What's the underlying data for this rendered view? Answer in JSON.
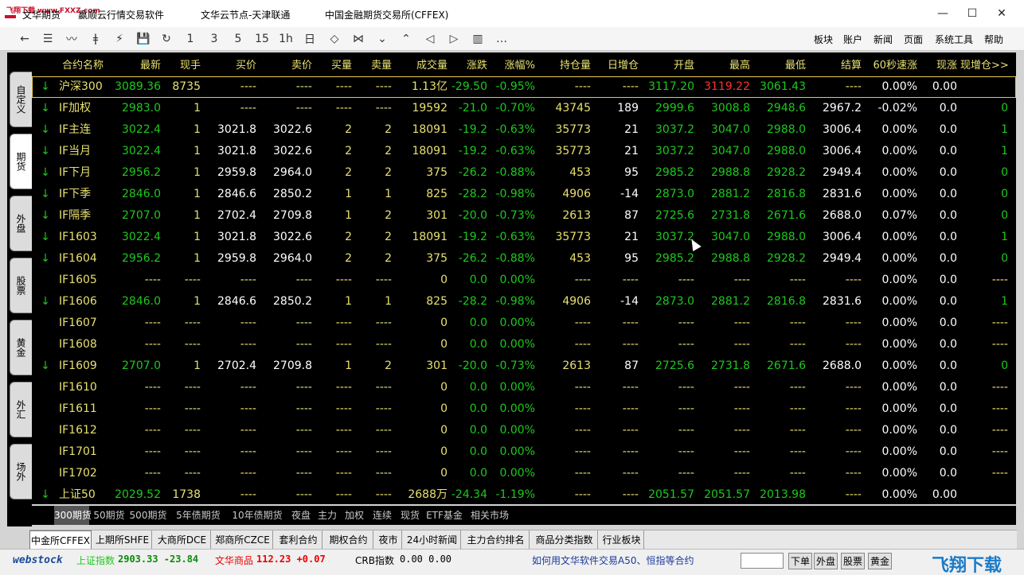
{
  "titlebar": {
    "watermark": "飞翔下载 www.FXXZ.com",
    "t1": "文华期货",
    "t2": "赢顺云行情交易软件",
    "t3": "文华云节点-天津联通",
    "t4": "中国金融期货交易所(CFFEX)",
    "min": "—",
    "max": "☐",
    "close": "✕"
  },
  "toolbar": {
    "icons": [
      "←",
      "☰",
      "〰",
      "ǂ",
      "⚡",
      "💾",
      "↻",
      "1",
      "3",
      "5",
      "15",
      "1h",
      "日",
      "◇",
      "⋈",
      "⌄",
      "⌃",
      "◁",
      "▷",
      "▥",
      "…"
    ],
    "menus": [
      "板块",
      "账户",
      "新闻",
      "页面",
      "系统工具",
      "帮助"
    ]
  },
  "sidetabs": [
    "自定义",
    "期货",
    "外盘",
    "股票",
    "黄金",
    "外汇",
    "场外"
  ],
  "columns": [
    "合约名称",
    "最新",
    "现手",
    "买价",
    "卖价",
    "买量",
    "卖量",
    "成交量",
    "涨跌",
    "涨幅%",
    "持仓量",
    "日增仓",
    "开盘",
    "最高",
    "最低",
    "结算",
    "60秒速涨",
    "现涨",
    "现增仓>>"
  ],
  "rows": [
    {
      "arrow": "↓",
      "name": "沪深300",
      "cells": [
        "3089.36",
        "8735",
        "----",
        "----",
        "----",
        "----",
        "1.13亿",
        "-29.50",
        "-0.95%",
        "----",
        "----",
        "3117.20",
        "3119.22",
        "3061.43",
        "----",
        "0.00%",
        "0.00",
        ""
      ],
      "hi": "3119.22"
    },
    {
      "arrow": "↓",
      "name": "IF加权",
      "cells": [
        "2983.0",
        "1",
        "----",
        "----",
        "----",
        "----",
        "19592",
        "-21.0",
        "-0.70%",
        "43745",
        "189",
        "2999.6",
        "3008.8",
        "2948.6",
        "2967.2",
        "-0.02%",
        "0.0",
        "0"
      ]
    },
    {
      "arrow": "↓",
      "name": "IF主连",
      "cells": [
        "3022.4",
        "1",
        "3021.8",
        "3022.6",
        "2",
        "2",
        "18091",
        "-19.2",
        "-0.63%",
        "35773",
        "21",
        "3037.2",
        "3047.0",
        "2988.0",
        "3006.4",
        "0.00%",
        "0.0",
        "1"
      ]
    },
    {
      "arrow": "↓",
      "name": "IF当月",
      "cells": [
        "3022.4",
        "1",
        "3021.8",
        "3022.6",
        "2",
        "2",
        "18091",
        "-19.2",
        "-0.63%",
        "35773",
        "21",
        "3037.2",
        "3047.0",
        "2988.0",
        "3006.4",
        "0.00%",
        "0.0",
        "1"
      ]
    },
    {
      "arrow": "↓",
      "name": "IF下月",
      "cells": [
        "2956.2",
        "1",
        "2959.8",
        "2964.0",
        "2",
        "2",
        "375",
        "-26.2",
        "-0.88%",
        "453",
        "95",
        "2985.2",
        "2988.8",
        "2928.2",
        "2949.4",
        "0.00%",
        "0.0",
        "0"
      ]
    },
    {
      "arrow": "↓",
      "name": "IF下季",
      "cells": [
        "2846.0",
        "1",
        "2846.6",
        "2850.2",
        "1",
        "1",
        "825",
        "-28.2",
        "-0.98%",
        "4906",
        "-14",
        "2873.0",
        "2881.2",
        "2816.8",
        "2831.6",
        "0.00%",
        "0.0",
        "0"
      ]
    },
    {
      "arrow": "↓",
      "name": "IF隔季",
      "cells": [
        "2707.0",
        "1",
        "2702.4",
        "2709.8",
        "1",
        "2",
        "301",
        "-20.0",
        "-0.73%",
        "2613",
        "87",
        "2725.6",
        "2731.8",
        "2671.6",
        "2688.0",
        "0.07%",
        "0.0",
        "0"
      ]
    },
    {
      "arrow": "↓",
      "name": "IF1603",
      "cells": [
        "3022.4",
        "1",
        "3021.8",
        "3022.6",
        "2",
        "2",
        "18091",
        "-19.2",
        "-0.63%",
        "35773",
        "21",
        "3037.2",
        "3047.0",
        "2988.0",
        "3006.4",
        "0.00%",
        "0.0",
        "1"
      ]
    },
    {
      "arrow": "↓",
      "name": "IF1604",
      "cells": [
        "2956.2",
        "1",
        "2959.8",
        "2964.0",
        "2",
        "2",
        "375",
        "-26.2",
        "-0.88%",
        "453",
        "95",
        "2985.2",
        "2988.8",
        "2928.2",
        "2949.4",
        "0.00%",
        "0.0",
        "0"
      ]
    },
    {
      "arrow": "",
      "name": "IF1605",
      "cells": [
        "----",
        "----",
        "----",
        "----",
        "----",
        "----",
        "0",
        "0.0",
        "0.00%",
        "----",
        "----",
        "----",
        "----",
        "----",
        "----",
        "0.00%",
        "0.0",
        "----"
      ]
    },
    {
      "arrow": "↓",
      "name": "IF1606",
      "cells": [
        "2846.0",
        "1",
        "2846.6",
        "2850.2",
        "1",
        "1",
        "825",
        "-28.2",
        "-0.98%",
        "4906",
        "-14",
        "2873.0",
        "2881.2",
        "2816.8",
        "2831.6",
        "0.00%",
        "0.0",
        "1"
      ]
    },
    {
      "arrow": "",
      "name": "IF1607",
      "cells": [
        "----",
        "----",
        "----",
        "----",
        "----",
        "----",
        "0",
        "0.0",
        "0.00%",
        "----",
        "----",
        "----",
        "----",
        "----",
        "----",
        "0.00%",
        "0.0",
        "----"
      ]
    },
    {
      "arrow": "",
      "name": "IF1608",
      "cells": [
        "----",
        "----",
        "----",
        "----",
        "----",
        "----",
        "0",
        "0.0",
        "0.00%",
        "----",
        "----",
        "----",
        "----",
        "----",
        "----",
        "0.00%",
        "0.0",
        "----"
      ]
    },
    {
      "arrow": "↓",
      "name": "IF1609",
      "cells": [
        "2707.0",
        "1",
        "2702.4",
        "2709.8",
        "1",
        "2",
        "301",
        "-20.0",
        "-0.73%",
        "2613",
        "87",
        "2725.6",
        "2731.8",
        "2671.6",
        "2688.0",
        "0.00%",
        "0.0",
        "0"
      ]
    },
    {
      "arrow": "",
      "name": "IF1610",
      "cells": [
        "----",
        "----",
        "----",
        "----",
        "----",
        "----",
        "0",
        "0.0",
        "0.00%",
        "----",
        "----",
        "----",
        "----",
        "----",
        "----",
        "0.00%",
        "0.0",
        "----"
      ]
    },
    {
      "arrow": "",
      "name": "IF1611",
      "cells": [
        "----",
        "----",
        "----",
        "----",
        "----",
        "----",
        "0",
        "0.0",
        "0.00%",
        "----",
        "----",
        "----",
        "----",
        "----",
        "----",
        "0.00%",
        "0.0",
        "----"
      ]
    },
    {
      "arrow": "",
      "name": "IF1612",
      "cells": [
        "----",
        "----",
        "----",
        "----",
        "----",
        "----",
        "0",
        "0.0",
        "0.00%",
        "----",
        "----",
        "----",
        "----",
        "----",
        "----",
        "0.00%",
        "0.0",
        "----"
      ]
    },
    {
      "arrow": "",
      "name": "IF1701",
      "cells": [
        "----",
        "----",
        "----",
        "----",
        "----",
        "----",
        "0",
        "0.0",
        "0.00%",
        "----",
        "----",
        "----",
        "----",
        "----",
        "----",
        "0.00%",
        "0.0",
        "----"
      ]
    },
    {
      "arrow": "",
      "name": "IF1702",
      "cells": [
        "----",
        "----",
        "----",
        "----",
        "----",
        "----",
        "0",
        "0.0",
        "0.00%",
        "----",
        "----",
        "----",
        "----",
        "----",
        "----",
        "0.00%",
        "0.0",
        "----"
      ]
    },
    {
      "arrow": "↓",
      "name": "上证50",
      "cells": [
        "2029.52",
        "1738",
        "----",
        "----",
        "----",
        "----",
        "2688万",
        "-24.34",
        "-1.19%",
        "----",
        "----",
        "2051.57",
        "2051.57",
        "2013.98",
        "----",
        "0.00%",
        "0.00",
        ""
      ]
    }
  ],
  "tabs1": [
    "300期货",
    "50期货",
    "500期货",
    "5年债期货",
    "10年债期货",
    "夜盘",
    "主力",
    "加权",
    "连续",
    "现货",
    "ETF基金",
    "相关市场"
  ],
  "tabs2": [
    "中金所CFFEX",
    "上期所SHFE",
    "大商所DCE",
    "郑商所CZCE",
    "套利合约",
    "期权合约",
    "夜市",
    "24小时新闻",
    "主力合约排名",
    "商品分类指数",
    "行业板块"
  ],
  "status": {
    "logo": "webstock",
    "sh_label": "上证指数",
    "sh_val": "2903.33 -23.84",
    "wh_label": "文华商品",
    "wh_val": "112.23 +0.07",
    "crb_label": "CRB指数",
    "crb_val": "0.00 0.00",
    "news": "如何用文华软件交易A50、恒指等合约",
    "b1": "下单",
    "b2": "外盘",
    "b3": "股票",
    "b4": "黄金",
    "watermark": "飞翔下载"
  }
}
